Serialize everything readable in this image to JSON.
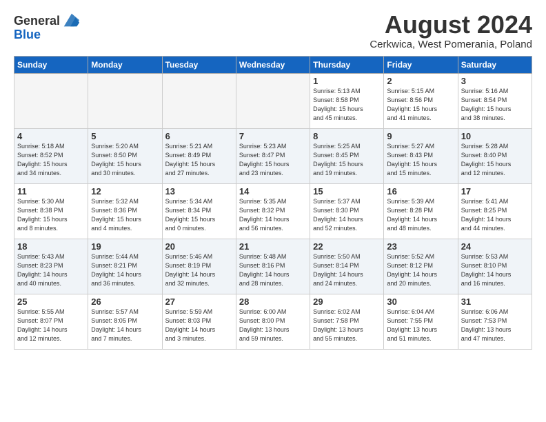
{
  "header": {
    "logo_line1": "General",
    "logo_line2": "Blue",
    "month_title": "August 2024",
    "subtitle": "Cerkwica, West Pomerania, Poland"
  },
  "days_of_week": [
    "Sunday",
    "Monday",
    "Tuesday",
    "Wednesday",
    "Thursday",
    "Friday",
    "Saturday"
  ],
  "weeks": [
    [
      {
        "day": "",
        "info": ""
      },
      {
        "day": "",
        "info": ""
      },
      {
        "day": "",
        "info": ""
      },
      {
        "day": "",
        "info": ""
      },
      {
        "day": "1",
        "info": "Sunrise: 5:13 AM\nSunset: 8:58 PM\nDaylight: 15 hours\nand 45 minutes."
      },
      {
        "day": "2",
        "info": "Sunrise: 5:15 AM\nSunset: 8:56 PM\nDaylight: 15 hours\nand 41 minutes."
      },
      {
        "day": "3",
        "info": "Sunrise: 5:16 AM\nSunset: 8:54 PM\nDaylight: 15 hours\nand 38 minutes."
      }
    ],
    [
      {
        "day": "4",
        "info": "Sunrise: 5:18 AM\nSunset: 8:52 PM\nDaylight: 15 hours\nand 34 minutes."
      },
      {
        "day": "5",
        "info": "Sunrise: 5:20 AM\nSunset: 8:50 PM\nDaylight: 15 hours\nand 30 minutes."
      },
      {
        "day": "6",
        "info": "Sunrise: 5:21 AM\nSunset: 8:49 PM\nDaylight: 15 hours\nand 27 minutes."
      },
      {
        "day": "7",
        "info": "Sunrise: 5:23 AM\nSunset: 8:47 PM\nDaylight: 15 hours\nand 23 minutes."
      },
      {
        "day": "8",
        "info": "Sunrise: 5:25 AM\nSunset: 8:45 PM\nDaylight: 15 hours\nand 19 minutes."
      },
      {
        "day": "9",
        "info": "Sunrise: 5:27 AM\nSunset: 8:43 PM\nDaylight: 15 hours\nand 15 minutes."
      },
      {
        "day": "10",
        "info": "Sunrise: 5:28 AM\nSunset: 8:40 PM\nDaylight: 15 hours\nand 12 minutes."
      }
    ],
    [
      {
        "day": "11",
        "info": "Sunrise: 5:30 AM\nSunset: 8:38 PM\nDaylight: 15 hours\nand 8 minutes."
      },
      {
        "day": "12",
        "info": "Sunrise: 5:32 AM\nSunset: 8:36 PM\nDaylight: 15 hours\nand 4 minutes."
      },
      {
        "day": "13",
        "info": "Sunrise: 5:34 AM\nSunset: 8:34 PM\nDaylight: 15 hours\nand 0 minutes."
      },
      {
        "day": "14",
        "info": "Sunrise: 5:35 AM\nSunset: 8:32 PM\nDaylight: 14 hours\nand 56 minutes."
      },
      {
        "day": "15",
        "info": "Sunrise: 5:37 AM\nSunset: 8:30 PM\nDaylight: 14 hours\nand 52 minutes."
      },
      {
        "day": "16",
        "info": "Sunrise: 5:39 AM\nSunset: 8:28 PM\nDaylight: 14 hours\nand 48 minutes."
      },
      {
        "day": "17",
        "info": "Sunrise: 5:41 AM\nSunset: 8:25 PM\nDaylight: 14 hours\nand 44 minutes."
      }
    ],
    [
      {
        "day": "18",
        "info": "Sunrise: 5:43 AM\nSunset: 8:23 PM\nDaylight: 14 hours\nand 40 minutes."
      },
      {
        "day": "19",
        "info": "Sunrise: 5:44 AM\nSunset: 8:21 PM\nDaylight: 14 hours\nand 36 minutes."
      },
      {
        "day": "20",
        "info": "Sunrise: 5:46 AM\nSunset: 8:19 PM\nDaylight: 14 hours\nand 32 minutes."
      },
      {
        "day": "21",
        "info": "Sunrise: 5:48 AM\nSunset: 8:16 PM\nDaylight: 14 hours\nand 28 minutes."
      },
      {
        "day": "22",
        "info": "Sunrise: 5:50 AM\nSunset: 8:14 PM\nDaylight: 14 hours\nand 24 minutes."
      },
      {
        "day": "23",
        "info": "Sunrise: 5:52 AM\nSunset: 8:12 PM\nDaylight: 14 hours\nand 20 minutes."
      },
      {
        "day": "24",
        "info": "Sunrise: 5:53 AM\nSunset: 8:10 PM\nDaylight: 14 hours\nand 16 minutes."
      }
    ],
    [
      {
        "day": "25",
        "info": "Sunrise: 5:55 AM\nSunset: 8:07 PM\nDaylight: 14 hours\nand 12 minutes."
      },
      {
        "day": "26",
        "info": "Sunrise: 5:57 AM\nSunset: 8:05 PM\nDaylight: 14 hours\nand 7 minutes."
      },
      {
        "day": "27",
        "info": "Sunrise: 5:59 AM\nSunset: 8:03 PM\nDaylight: 14 hours\nand 3 minutes."
      },
      {
        "day": "28",
        "info": "Sunrise: 6:00 AM\nSunset: 8:00 PM\nDaylight: 13 hours\nand 59 minutes."
      },
      {
        "day": "29",
        "info": "Sunrise: 6:02 AM\nSunset: 7:58 PM\nDaylight: 13 hours\nand 55 minutes."
      },
      {
        "day": "30",
        "info": "Sunrise: 6:04 AM\nSunset: 7:55 PM\nDaylight: 13 hours\nand 51 minutes."
      },
      {
        "day": "31",
        "info": "Sunrise: 6:06 AM\nSunset: 7:53 PM\nDaylight: 13 hours\nand 47 minutes."
      }
    ]
  ]
}
